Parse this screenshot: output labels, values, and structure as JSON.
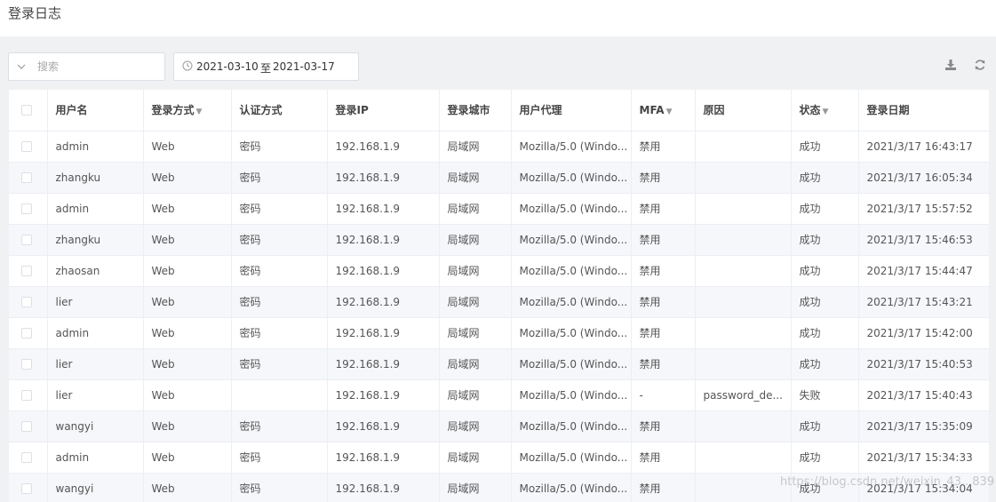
{
  "page": {
    "title": "登录日志"
  },
  "toolbar": {
    "search_placeholder": "搜索",
    "date_start": "2021-03-10",
    "date_sep": "至",
    "date_end": "2021-03-17"
  },
  "table": {
    "headers": [
      "用户名",
      "登录方式",
      "认证方式",
      "登录IP",
      "登录城市",
      "用户代理",
      "MFA",
      "原因",
      "状态",
      "登录日期"
    ],
    "rows": [
      [
        "admin",
        "Web",
        "密码",
        "192.168.1.9",
        "局域网",
        "Mozilla/5.0 (Windo...",
        "禁用",
        "",
        "成功",
        "2021/3/17 16:43:17"
      ],
      [
        "zhangku",
        "Web",
        "密码",
        "192.168.1.9",
        "局域网",
        "Mozilla/5.0 (Windo...",
        "禁用",
        "",
        "成功",
        "2021/3/17 16:05:34"
      ],
      [
        "admin",
        "Web",
        "密码",
        "192.168.1.9",
        "局域网",
        "Mozilla/5.0 (Windo...",
        "禁用",
        "",
        "成功",
        "2021/3/17 15:57:52"
      ],
      [
        "zhangku",
        "Web",
        "密码",
        "192.168.1.9",
        "局域网",
        "Mozilla/5.0 (Windo...",
        "禁用",
        "",
        "成功",
        "2021/3/17 15:46:53"
      ],
      [
        "zhaosan",
        "Web",
        "密码",
        "192.168.1.9",
        "局域网",
        "Mozilla/5.0 (Windo...",
        "禁用",
        "",
        "成功",
        "2021/3/17 15:44:47"
      ],
      [
        "lier",
        "Web",
        "密码",
        "192.168.1.9",
        "局域网",
        "Mozilla/5.0 (Windo...",
        "禁用",
        "",
        "成功",
        "2021/3/17 15:43:21"
      ],
      [
        "admin",
        "Web",
        "密码",
        "192.168.1.9",
        "局域网",
        "Mozilla/5.0 (Windo...",
        "禁用",
        "",
        "成功",
        "2021/3/17 15:42:00"
      ],
      [
        "lier",
        "Web",
        "密码",
        "192.168.1.9",
        "局域网",
        "Mozilla/5.0 (Windo...",
        "禁用",
        "",
        "成功",
        "2021/3/17 15:40:53"
      ],
      [
        "lier",
        "Web",
        "",
        "192.168.1.9",
        "局域网",
        "Mozilla/5.0 (Windo...",
        "-",
        "password_de...",
        "失败",
        "2021/3/17 15:40:43"
      ],
      [
        "wangyi",
        "Web",
        "密码",
        "192.168.1.9",
        "局域网",
        "Mozilla/5.0 (Windo...",
        "禁用",
        "",
        "成功",
        "2021/3/17 15:35:09"
      ],
      [
        "admin",
        "Web",
        "密码",
        "192.168.1.9",
        "局域网",
        "Mozilla/5.0 (Windo...",
        "禁用",
        "",
        "成功",
        "2021/3/17 15:34:33"
      ],
      [
        "wangyi",
        "Web",
        "密码",
        "192.168.1.9",
        "局域网",
        "Mozilla/5.0 (Windo...",
        "禁用",
        "",
        "成功",
        "2021/3/17 15:34:04"
      ]
    ]
  },
  "watermark": "https://blog.csdn.net/weixin_43...839",
  "icons": {
    "search_toggle": "chevron-down-icon",
    "date": "clock-icon",
    "export": "download-icon",
    "refresh": "refresh-icon",
    "sort": "sort-caret-icon"
  },
  "colors": {
    "background": "#f0f1f3",
    "table_border": "#ebeef5",
    "row_stripe": "#f5f7fa",
    "text": "#555555"
  }
}
